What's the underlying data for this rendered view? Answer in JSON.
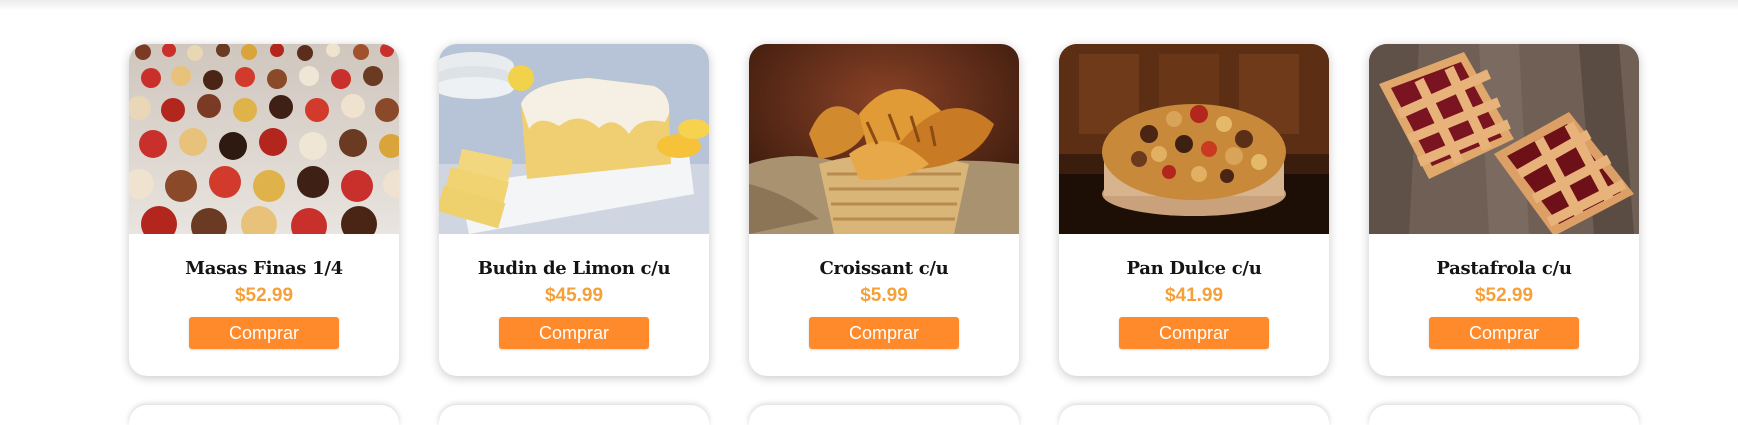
{
  "theme": {
    "accent": "#ff8a2b",
    "price_color": "#f4a13a"
  },
  "products": [
    {
      "name": "Masas Finas 1/4",
      "price": "$52.99",
      "button_label": "Comprar",
      "image": "assorted-pastries-photo"
    },
    {
      "name": "Budin de Limon c/u",
      "price": "$45.99",
      "button_label": "Comprar",
      "image": "lemon-loaf-cake-photo"
    },
    {
      "name": "Croissant c/u",
      "price": "$5.99",
      "button_label": "Comprar",
      "image": "croissant-basket-photo"
    },
    {
      "name": "Pan Dulce c/u",
      "price": "$41.99",
      "button_label": "Comprar",
      "image": "panettone-photo"
    },
    {
      "name": "Pastafrola c/u",
      "price": "$52.99",
      "button_label": "Comprar",
      "image": "pastafrola-tart-photo"
    }
  ]
}
